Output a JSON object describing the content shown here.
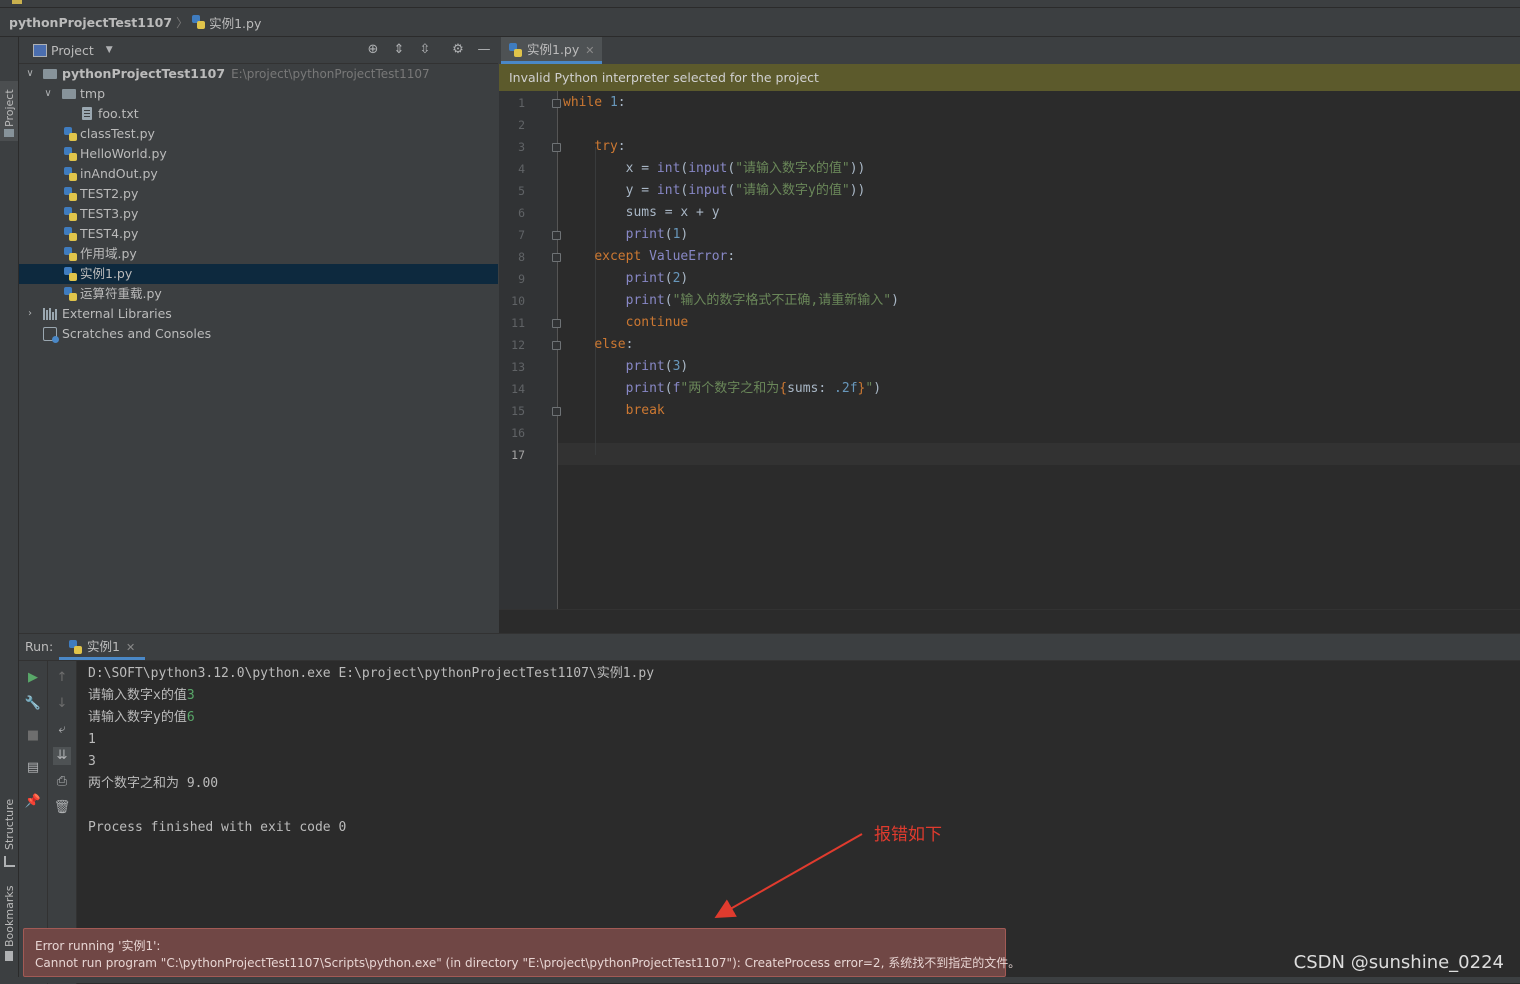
{
  "navbar": {
    "project": "pythonProjectTest1107",
    "file": "实例1.py"
  },
  "side_tools": {
    "project": "Project",
    "structure": "Structure",
    "bookmarks": "Bookmarks"
  },
  "project_panel": {
    "title": "Project",
    "root": {
      "name": "pythonProjectTest1107",
      "path": "E:\\project\\pythonProjectTest1107"
    },
    "items": [
      {
        "label": "tmp",
        "type": "folder",
        "depth": 1,
        "expanded": true
      },
      {
        "label": "foo.txt",
        "type": "txt",
        "depth": 2
      },
      {
        "label": "classTest.py",
        "type": "py",
        "depth": 1
      },
      {
        "label": "HelloWorld.py",
        "type": "py",
        "depth": 1
      },
      {
        "label": "inAndOut.py",
        "type": "py",
        "depth": 1
      },
      {
        "label": "TEST2.py",
        "type": "py",
        "depth": 1
      },
      {
        "label": "TEST3.py",
        "type": "py",
        "depth": 1
      },
      {
        "label": "TEST4.py",
        "type": "py",
        "depth": 1
      },
      {
        "label": "作用域.py",
        "type": "py",
        "depth": 1
      },
      {
        "label": "实例1.py",
        "type": "py",
        "depth": 1,
        "selected": true
      },
      {
        "label": "运算符重载.py",
        "type": "py",
        "depth": 1
      },
      {
        "label": "External Libraries",
        "type": "lib",
        "depth": 0
      },
      {
        "label": "Scratches and Consoles",
        "type": "scratch",
        "depth": 0
      }
    ]
  },
  "editor": {
    "tab_label": "实例1.py",
    "warning": "Invalid Python interpreter selected for the project",
    "current_line": 17,
    "lines": [
      "while 1:",
      "",
      "    try:",
      "        x = int(input(\"请输入数字x的值\"))",
      "        y = int(input(\"请输入数字y的值\"))",
      "        sums = x + y",
      "        print(1)",
      "    except ValueError:",
      "        print(2)",
      "        print(\"输入的数字格式不正确,请重新输入\")",
      "        continue",
      "    else:",
      "        print(3)",
      "        print(f\"两个数字之和为{sums: .2f}\")",
      "        break",
      "",
      ""
    ]
  },
  "run_panel": {
    "label": "Run:",
    "tab_label": "实例1",
    "console": [
      {
        "text": "D:\\SOFT\\python3.12.0\\python.exe E:\\project\\pythonProjectTest1107\\实例1.py",
        "input": ""
      },
      {
        "text": "请输入数字x的值",
        "input": "3"
      },
      {
        "text": "请输入数字y的值",
        "input": "6"
      },
      {
        "text": "1",
        "input": ""
      },
      {
        "text": "3",
        "input": ""
      },
      {
        "text": "两个数字之和为 9.00",
        "input": ""
      },
      {
        "text": "",
        "input": ""
      },
      {
        "text": "Process finished with exit code 0",
        "input": ""
      }
    ]
  },
  "annotation": {
    "text": "报错如下",
    "color": "#e03b2e"
  },
  "error_popup": {
    "line1": "Error running '实例1':",
    "line2": "Cannot run program \"C:\\pythonProjectTest1107\\Scripts\\python.exe\" (in directory \"E:\\project\\pythonProjectTest1107\"): CreateProcess error=2, 系统找不到指定的文件。"
  },
  "watermark": "CSDN @sunshine_0224",
  "colors": {
    "keyword": "#cc7832",
    "number": "#6897bb",
    "builtin": "#8888c6",
    "string": "#6a8759",
    "warning_bg": "#5c5a2c",
    "error_bg": "#704745"
  }
}
